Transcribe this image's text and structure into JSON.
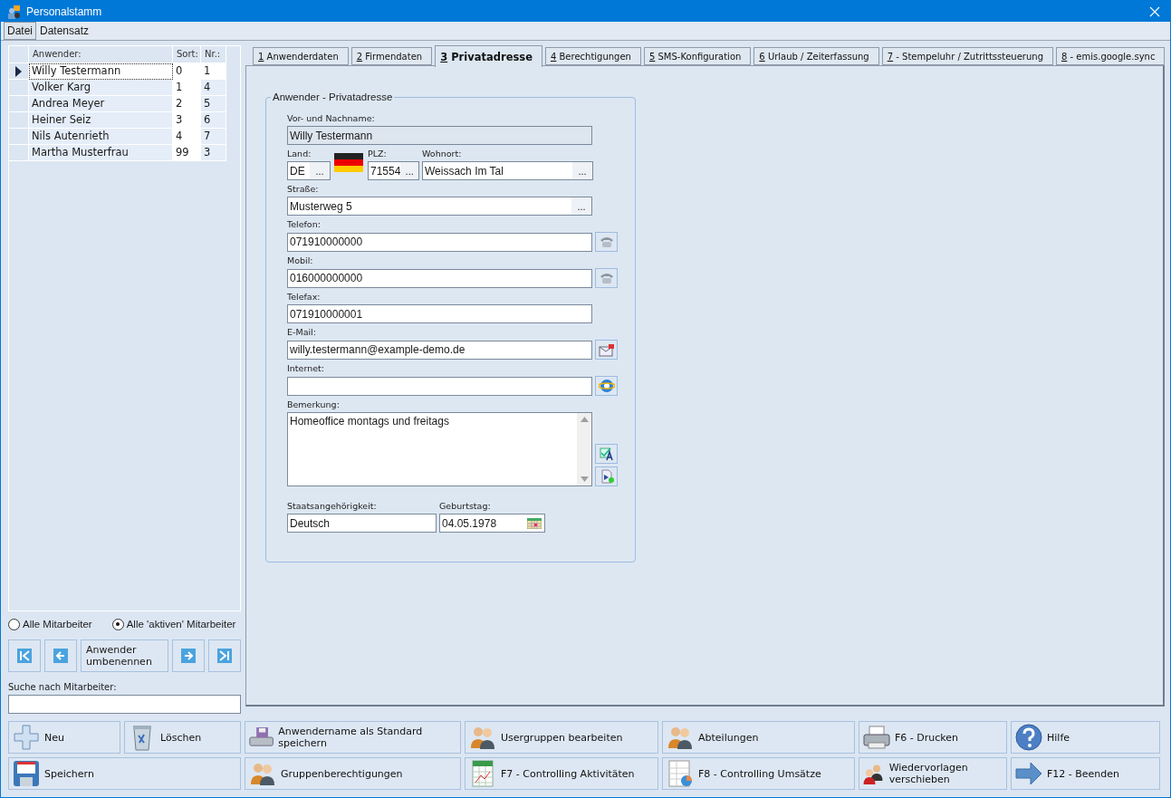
{
  "window": {
    "title": "Personalstamm"
  },
  "menu": [
    {
      "label": "Datei",
      "selected": true
    },
    {
      "label": "Datensatz",
      "selected": false
    }
  ],
  "employees": {
    "columns": [
      "Anwender:",
      "Sort:",
      "Nr.:"
    ],
    "rows": [
      {
        "name": "Willy Testermann",
        "sort": "0",
        "nr": "1",
        "selected": true
      },
      {
        "name": "Volker Karg",
        "sort": "1",
        "nr": "4",
        "selected": false
      },
      {
        "name": "Andrea Meyer",
        "sort": "2",
        "nr": "5",
        "selected": false
      },
      {
        "name": "Heiner Seiz",
        "sort": "3",
        "nr": "6",
        "selected": false
      },
      {
        "name": "Nils Autenrieth",
        "sort": "4",
        "nr": "7",
        "selected": false
      },
      {
        "name": "Martha Musterfrau",
        "sort": "99",
        "nr": "3",
        "selected": false
      }
    ]
  },
  "filter": [
    {
      "label": "Alle Mitarbeiter",
      "selected": false
    },
    {
      "label": "Alle 'aktiven' Mitarbeiter",
      "selected": true
    }
  ],
  "navigation": [
    {
      "kind": "first"
    },
    {
      "kind": "prev"
    },
    {
      "kind": "text",
      "label": "Anwender umbenennen"
    },
    {
      "kind": "next"
    },
    {
      "kind": "last"
    }
  ],
  "search": {
    "label": "Suche nach Mitarbeiter:"
  },
  "tabs": [
    {
      "key": "1",
      "label": "Anwenderdaten",
      "selected": false
    },
    {
      "key": "2",
      "label": "Firmendaten",
      "selected": false
    },
    {
      "key": "3",
      "label": "Privatadresse",
      "selected": true
    },
    {
      "key": "4",
      "label": "Berechtigungen",
      "selected": false
    },
    {
      "key": "5",
      "label": "SMS-Konfiguration",
      "selected": false
    },
    {
      "key": "6",
      "label": "Urlaub / Zeiterfassung",
      "selected": false
    },
    {
      "key": "7",
      "label": "- Stempeluhr / Zutrittssteuerung",
      "selected": false
    },
    {
      "key": "8",
      "label": "- emis.google.sync",
      "selected": false
    }
  ],
  "address": {
    "title": "Anwender - Privatadresse",
    "name": {
      "label": "Vor- und Nachname:",
      "value": "Willy Testermann",
      "disabled": true
    },
    "land": {
      "label": "Land:",
      "value": "DE",
      "browse": "..."
    },
    "plz": {
      "label": "PLZ:",
      "value": "71554",
      "browse": "..."
    },
    "wohnort": {
      "label": "Wohnort:",
      "value": "Weissach Im Tal",
      "browse": "..."
    },
    "strasse": {
      "label": "Straße:",
      "value": "Musterweg 5",
      "browse": "..."
    },
    "contacts": [
      {
        "label": "Telefon:",
        "value": "071910000000",
        "kind": "phone"
      },
      {
        "label": "Mobil:",
        "value": "016000000000",
        "kind": "phone"
      },
      {
        "label": "Telefax:",
        "value": "071910000001",
        "kind": "plain"
      },
      {
        "label": "E-Mail:",
        "value": "willy.testermann@example-demo.de",
        "kind": "mail"
      },
      {
        "label": "Internet:",
        "kind": "web"
      }
    ],
    "bemerkung": {
      "label": "Bemerkung:",
      "value": "Homeoffice montags und freitags"
    },
    "staat": {
      "label": "Staatsangehörigkeit:",
      "value": "Deutsch"
    },
    "geburtstag": {
      "label": "Geburtstag:",
      "value": "04.05.1978"
    }
  },
  "buttons": [
    {
      "label": "Neu",
      "kind": "plus"
    },
    {
      "label": "Löschen",
      "kind": "trash"
    },
    {
      "label": "Anwendername als Standard speichern",
      "kind": "drive"
    },
    {
      "label": "Usergruppen bearbeiten",
      "kind": "people"
    },
    {
      "label": "Abteilungen",
      "kind": "people"
    },
    {
      "label": "F6 - Drucken",
      "kind": "printer"
    },
    {
      "label": "Hilfe",
      "kind": "help"
    },
    {
      "label": "Speichern",
      "kind": "floppy"
    },
    {
      "label": "Gruppenberechtigungen",
      "kind": "people"
    },
    {
      "label": "F7 - Controlling Aktivitäten",
      "kind": "sheet"
    },
    {
      "label": "F8 - Controlling Umsätze",
      "kind": "chart"
    },
    {
      "label": "Wiedervorlagen verschieben",
      "kind": "swap"
    },
    {
      "label": "F12 - Beenden",
      "kind": "arrow"
    }
  ]
}
